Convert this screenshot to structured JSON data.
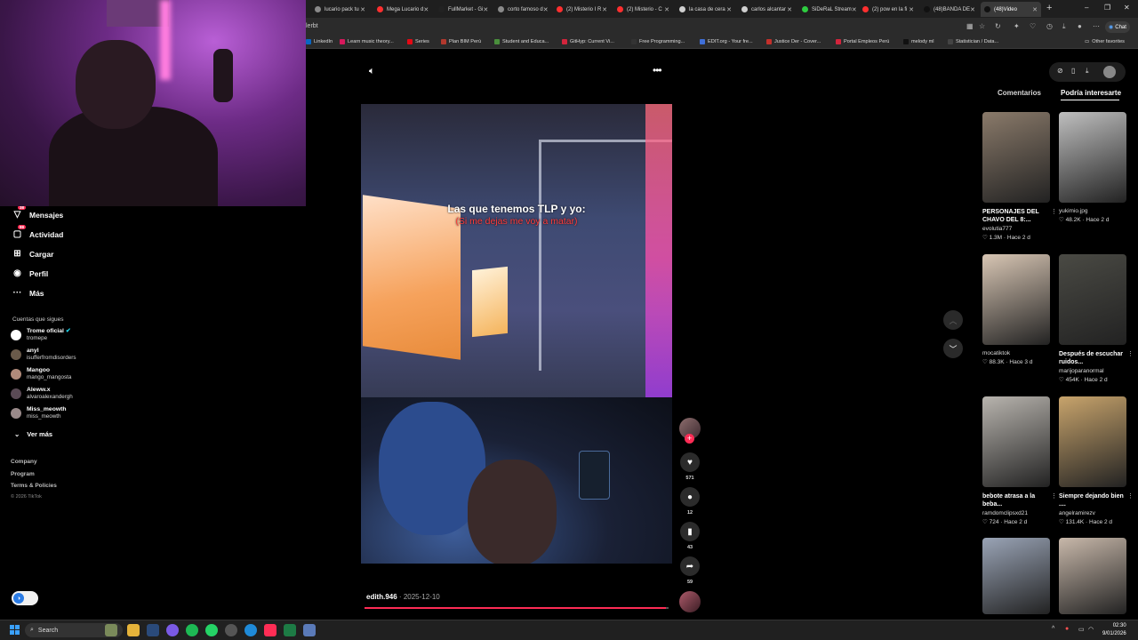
{
  "browser": {
    "tabs": [
      {
        "label": "lucario pack tu",
        "color": "#8a8a8a"
      },
      {
        "label": "Mega Lucario d",
        "color": "#ff2f2f"
      },
      {
        "label": "FullMarket - Gi",
        "color": "#222222"
      },
      {
        "label": "corto famoso d",
        "color": "#8a8a8a"
      },
      {
        "label": "(2) Misterio I R",
        "color": "#ff2f2f"
      },
      {
        "label": "(2) Misterio - C",
        "color": "#ff2f2f"
      },
      {
        "label": "la casa de cera",
        "color": "#cfcfcf"
      },
      {
        "label": "carlos alcantar",
        "color": "#cfcfcf"
      },
      {
        "label": "SiDeRaL Stream",
        "color": "#2ecc40"
      },
      {
        "label": "(2) pow en la fi",
        "color": "#ff2f2f"
      },
      {
        "label": "(48)BANDA DE",
        "color": "#111111"
      },
      {
        "label": "(48)Video",
        "color": "#111111"
      }
    ],
    "url_fragment": "lerbt",
    "chat_label": "Chat",
    "bookmarks": [
      {
        "label": "LinkedIn",
        "color": "#0a66c2"
      },
      {
        "label": "Learn music theory...",
        "color": "#d6185c"
      },
      {
        "label": "Series",
        "color": "#e50914"
      },
      {
        "label": "Plan BIM Perú",
        "color": "#b2382d"
      },
      {
        "label": "Student and Educa...",
        "color": "#4a8f3c"
      },
      {
        "label": "GitHyp: Current Vi...",
        "color": "#d3243c"
      },
      {
        "label": "Free Programming...",
        "color": "#333333"
      },
      {
        "label": "EDIT.org - Your fre...",
        "color": "#3f6fd8"
      },
      {
        "label": "Justice Der - Cover...",
        "color": "#c4302b"
      },
      {
        "label": "Portal Empleos Perú",
        "color": "#d3243c"
      },
      {
        "label": "melody ml",
        "color": "#111111"
      },
      {
        "label": "Statistician / Data...",
        "color": "#444444"
      }
    ],
    "other_favorites": "Other favorites"
  },
  "sidebar": {
    "nav": [
      {
        "label": "Mensajes",
        "icon": "send-icon",
        "badge": "38"
      },
      {
        "label": "Actividad",
        "icon": "inbox-icon",
        "badge": "99"
      },
      {
        "label": "Cargar",
        "icon": "plus-square-icon",
        "badge": ""
      },
      {
        "label": "Perfil",
        "icon": "avatar-icon",
        "badge": ""
      },
      {
        "label": "Más",
        "icon": "more-icon",
        "badge": ""
      }
    ],
    "following_title": "Cuentas que sigues",
    "accounts": [
      {
        "name": "Trome oficial",
        "handle": "tromepe",
        "verified": true,
        "color": "#ffffff"
      },
      {
        "name": "anyl",
        "handle": "isufferfromdisorders",
        "verified": false,
        "color": "#6a5a4a"
      },
      {
        "name": "Mangoo",
        "handle": "mango_mangosta",
        "verified": false,
        "color": "#b08a7a"
      },
      {
        "name": "Aleww.x",
        "handle": "alvaroalexandergh",
        "verified": false,
        "color": "#5a4a55"
      },
      {
        "name": "Miss_meowth",
        "handle": "miss_meowth",
        "verified": false,
        "color": "#9a8a8a"
      }
    ],
    "see_more": "Ver más",
    "footer_links": [
      "Company",
      "Program",
      "Terms & Policies"
    ],
    "copyright": "© 2026 TikTok"
  },
  "video": {
    "caption_line1": "Las que tenemos TLP y yo:",
    "caption_line2": "(Si me dejas me voy a matar)",
    "username": "edith.946",
    "date": "2025-12-10",
    "progress": 0.99,
    "likes": "571",
    "comments": "12",
    "saves": "43",
    "shares": "59"
  },
  "right_panel": {
    "tabs": [
      "Comentarios",
      "Podría interesarte"
    ],
    "active_tab": 1,
    "cards": [
      {
        "title": "PERSONAJES DEL CHAVO DEL 8:...",
        "user": "evolutia777",
        "likes": "1.3M",
        "ago": "Hace 2 d",
        "thumb": "#8a7a6a"
      },
      {
        "title": "",
        "user": "yukimio.jpg",
        "likes": "48.2K",
        "ago": "Hace 2 d",
        "thumb": "#bfbfbf"
      },
      {
        "title": "",
        "user": "mocatiktok",
        "likes": "88.3K",
        "ago": "Hace 3 d",
        "thumb": "#d8c6b4"
      },
      {
        "title": "Después de escuchar ruidos...",
        "user": "marijoparanormal",
        "likes": "454K",
        "ago": "Hace 2 d",
        "thumb": "#4a4a44"
      },
      {
        "title": "bebote atrasa a la beba...",
        "user": "ramdomclipsxd21",
        "likes": "724",
        "ago": "Hace 2 d",
        "thumb": "#b8b4ae"
      },
      {
        "title": "Siempre dejando bien ....",
        "user": "angelramirezv",
        "likes": "131.4K",
        "ago": "Hace 2 d",
        "thumb": "#c8a46c"
      },
      {
        "title": "",
        "user": "",
        "likes": "",
        "ago": "",
        "thumb": "#9aa4b6"
      },
      {
        "title": "",
        "user": "",
        "likes": "",
        "ago": "",
        "thumb": "#c8b8aa"
      }
    ]
  },
  "taskbar": {
    "search_label": "Search",
    "time": "02:30",
    "date": "9/01/2026"
  }
}
